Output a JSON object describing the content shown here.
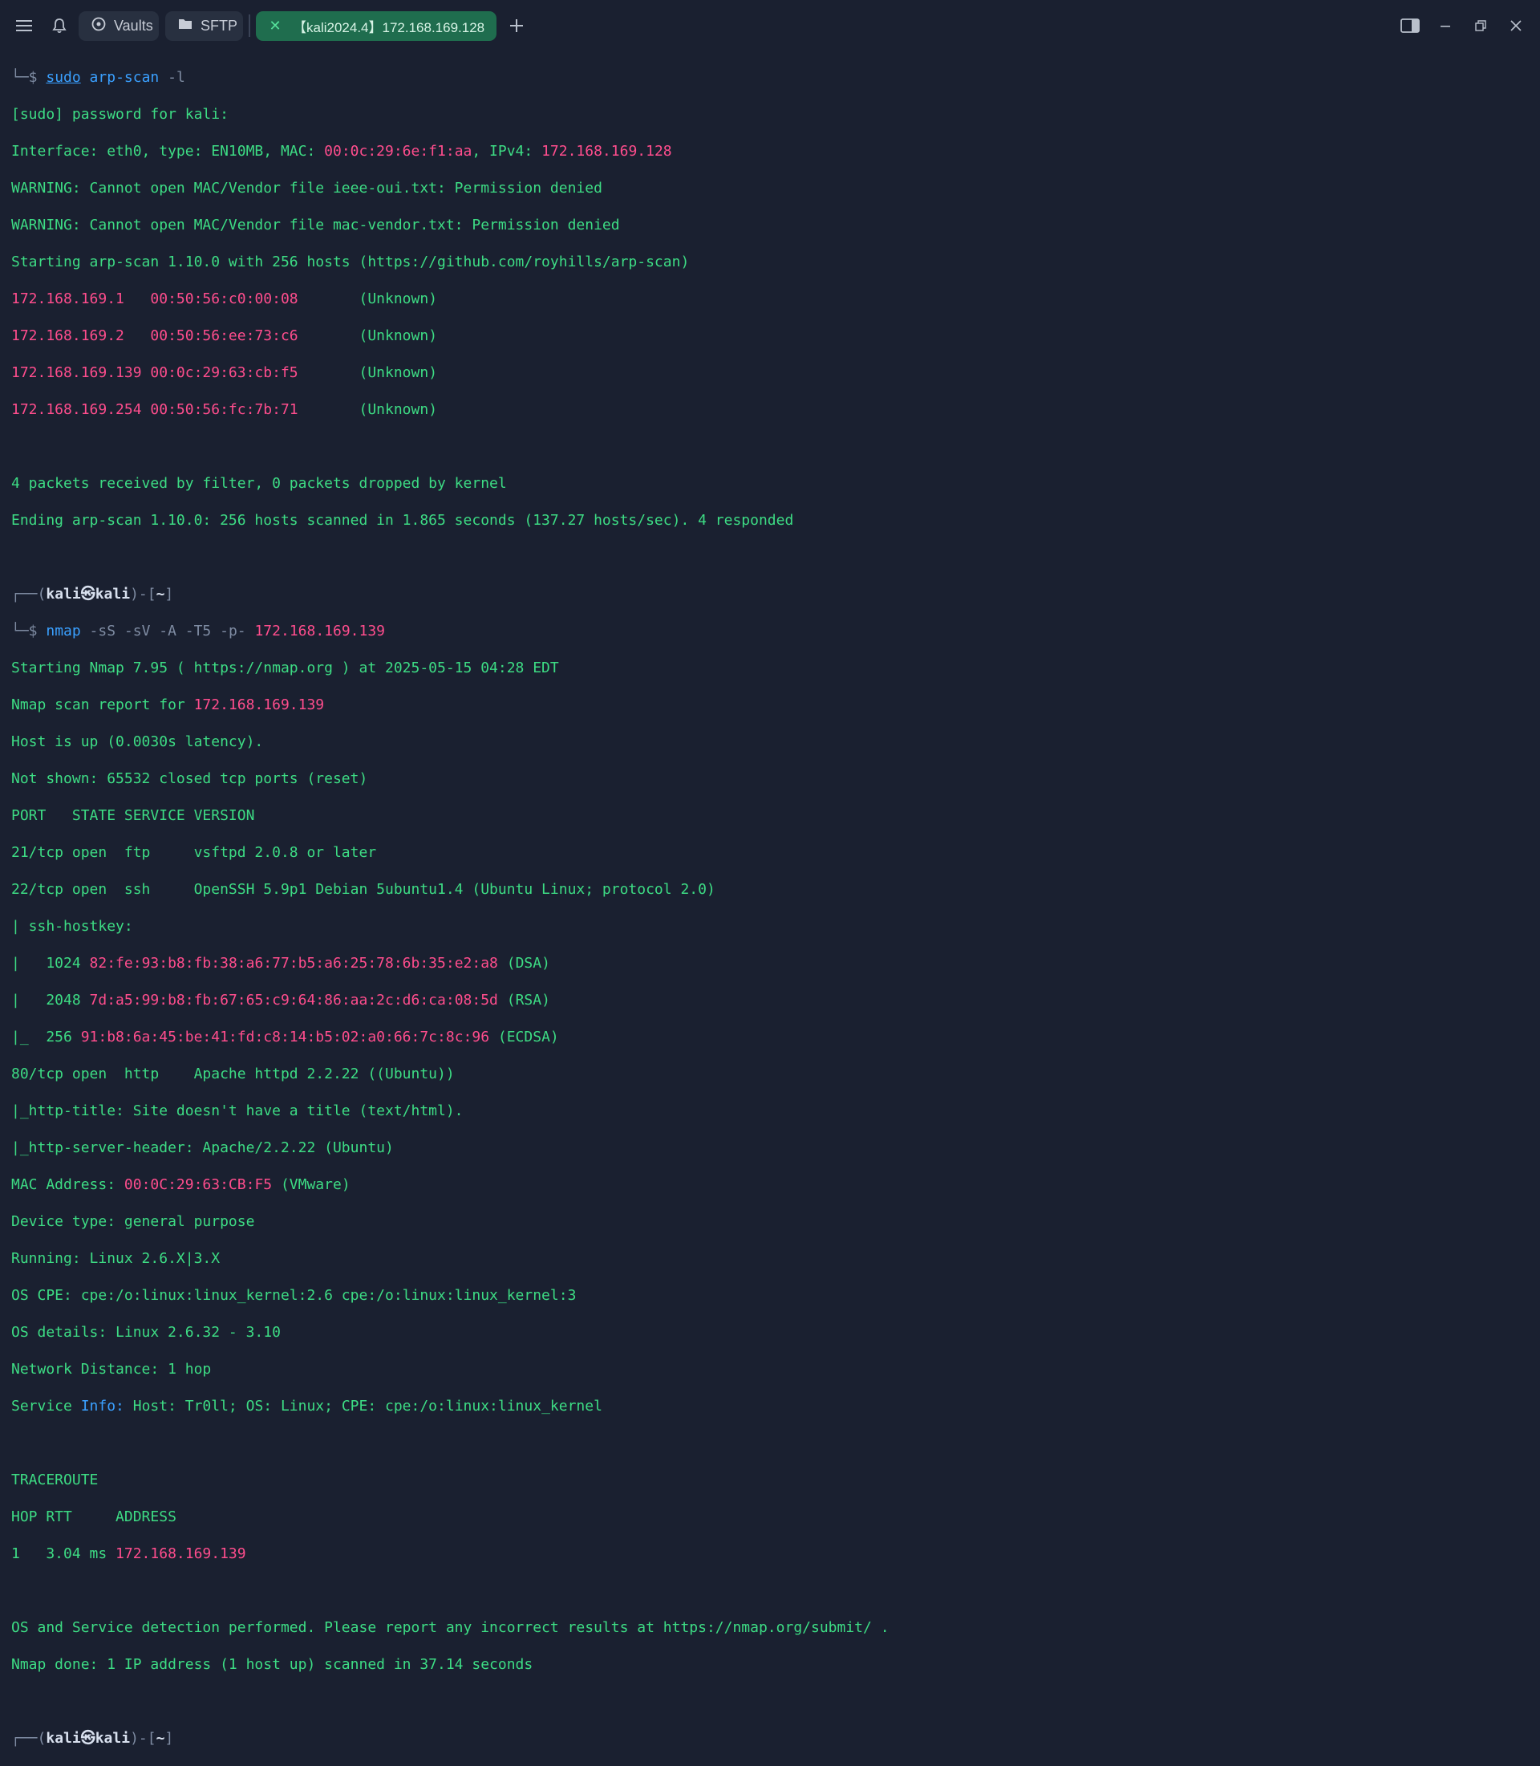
{
  "topbar": {
    "vaults_label": "Vaults",
    "sftp_label": "SFTP",
    "active_tab_label": "【kali2024.4】172.168.169.128",
    "icons": [
      "menu-icon",
      "bell-icon",
      "vaults-icon",
      "folder-icon",
      "close-icon",
      "plus-icon",
      "split-pane-icon",
      "minimize-icon",
      "restore-icon",
      "window-close-icon"
    ]
  },
  "terminal": {
    "l01": {
      "a": "└─$ ",
      "b": "sudo",
      "c": " arp-scan",
      "d": " -l"
    },
    "l02": "[sudo] password for kali:",
    "l03": {
      "a": "Interface: eth0, type: EN10MB, MAC: ",
      "b": "00:0c:29:6e:f1:aa",
      "c": ", IPv4: ",
      "d": "172.168.169.128"
    },
    "l04": "WARNING: Cannot open MAC/Vendor file ieee-oui.txt: Permission denied",
    "l05": "WARNING: Cannot open MAC/Vendor file mac-vendor.txt: Permission denied",
    "l06": "Starting arp-scan 1.10.0 with 256 hosts (https://github.com/royhills/arp-scan)",
    "hosts": [
      {
        "ip": "172.168.169.1  ",
        "mac": " 00:50:56:c0:00:08",
        "vendor": "       (Unknown)"
      },
      {
        "ip": "172.168.169.2  ",
        "mac": " 00:50:56:ee:73:c6",
        "vendor": "       (Unknown)"
      },
      {
        "ip": "172.168.169.139",
        "mac": " 00:0c:29:63:cb:f5",
        "vendor": "       (Unknown)"
      },
      {
        "ip": "172.168.169.254",
        "mac": " 00:50:56:fc:7b:71",
        "vendor": "       (Unknown)"
      }
    ],
    "l12": "4 packets received by filter, 0 packets dropped by kernel",
    "l13": "Ending arp-scan 1.10.0: 256 hosts scanned in 1.865 seconds (137.27 hosts/sec). 4 responded",
    "prompt": {
      "a": "┌──(",
      "b": "kali㉿kali",
      "c": ")-[",
      "d": "~",
      "e": "]"
    },
    "l16": {
      "a": "└─$ ",
      "b": "nmap",
      "c": " -sS -sV -A -T5 -p- ",
      "d": "172.168.169.139"
    },
    "l17": "Starting Nmap 7.95 ( https://nmap.org ) at 2025-05-15 04:28 EDT",
    "l18": {
      "a": "Nmap scan report for ",
      "b": "172.168.169.139"
    },
    "l19": "Host is up (0.0030s latency).",
    "l20": "Not shown: 65532 closed tcp ports (reset)",
    "l21": "PORT   STATE SERVICE VERSION",
    "l22": "21/tcp open  ftp     vsftpd 2.0.8 or later",
    "l23": "22/tcp open  ssh     OpenSSH 5.9p1 Debian 5ubuntu1.4 (Ubuntu Linux; protocol 2.0)",
    "l24": "| ssh-hostkey:",
    "keys": [
      {
        "a": "|   1024 ",
        "b": "82:fe:93:b8:fb:38:a6:77:b5:a6:25:78:6b:35:e2:a8",
        "c": " (DSA)"
      },
      {
        "a": "|   2048 ",
        "b": "7d:a5:99:b8:fb:67:65:c9:64:86:aa:2c:d6:ca:08:5d",
        "c": " (RSA)"
      },
      {
        "a": "|_  256 ",
        "b": "91:b8:6a:45:be:41:fd:c8:14:b5:02:a0:66:7c:8c:96",
        "c": " (ECDSA)"
      }
    ],
    "l28": "80/tcp open  http    Apache httpd 2.2.22 ((Ubuntu))",
    "l29": "|_http-title: Site doesn't have a title (text/html).",
    "l30": "|_http-server-header: Apache/2.2.22 (Ubuntu)",
    "l31": {
      "a": "MAC Address: ",
      "b": "00:0C:29:63:CB:F5",
      "c": " (VMware)"
    },
    "l32": "Device type: general purpose",
    "l33": "Running: Linux 2.6.X|3.X",
    "l34": "OS CPE: cpe:/o:linux:linux_kernel:2.6 cpe:/o:linux:linux_kernel:3",
    "l35": "OS details: Linux 2.6.32 - 3.10",
    "l36": "Network Distance: 1 hop",
    "l37": {
      "a": "Service ",
      "b": "Info:",
      "c": " Host: Tr0ll; OS: Linux; CPE: cpe:/o:linux:linux_kernel"
    },
    "l39": "TRACEROUTE",
    "l40": "HOP RTT     ADDRESS",
    "l41": {
      "a": "1   3.04 ms ",
      "b": "172.168.169.139"
    },
    "l43": "OS and Service detection performed. Please report any incorrect results at https://nmap.org/submit/ .",
    "l44": "Nmap done: 1 IP address (1 host up) scanned in 37.14 seconds"
  }
}
